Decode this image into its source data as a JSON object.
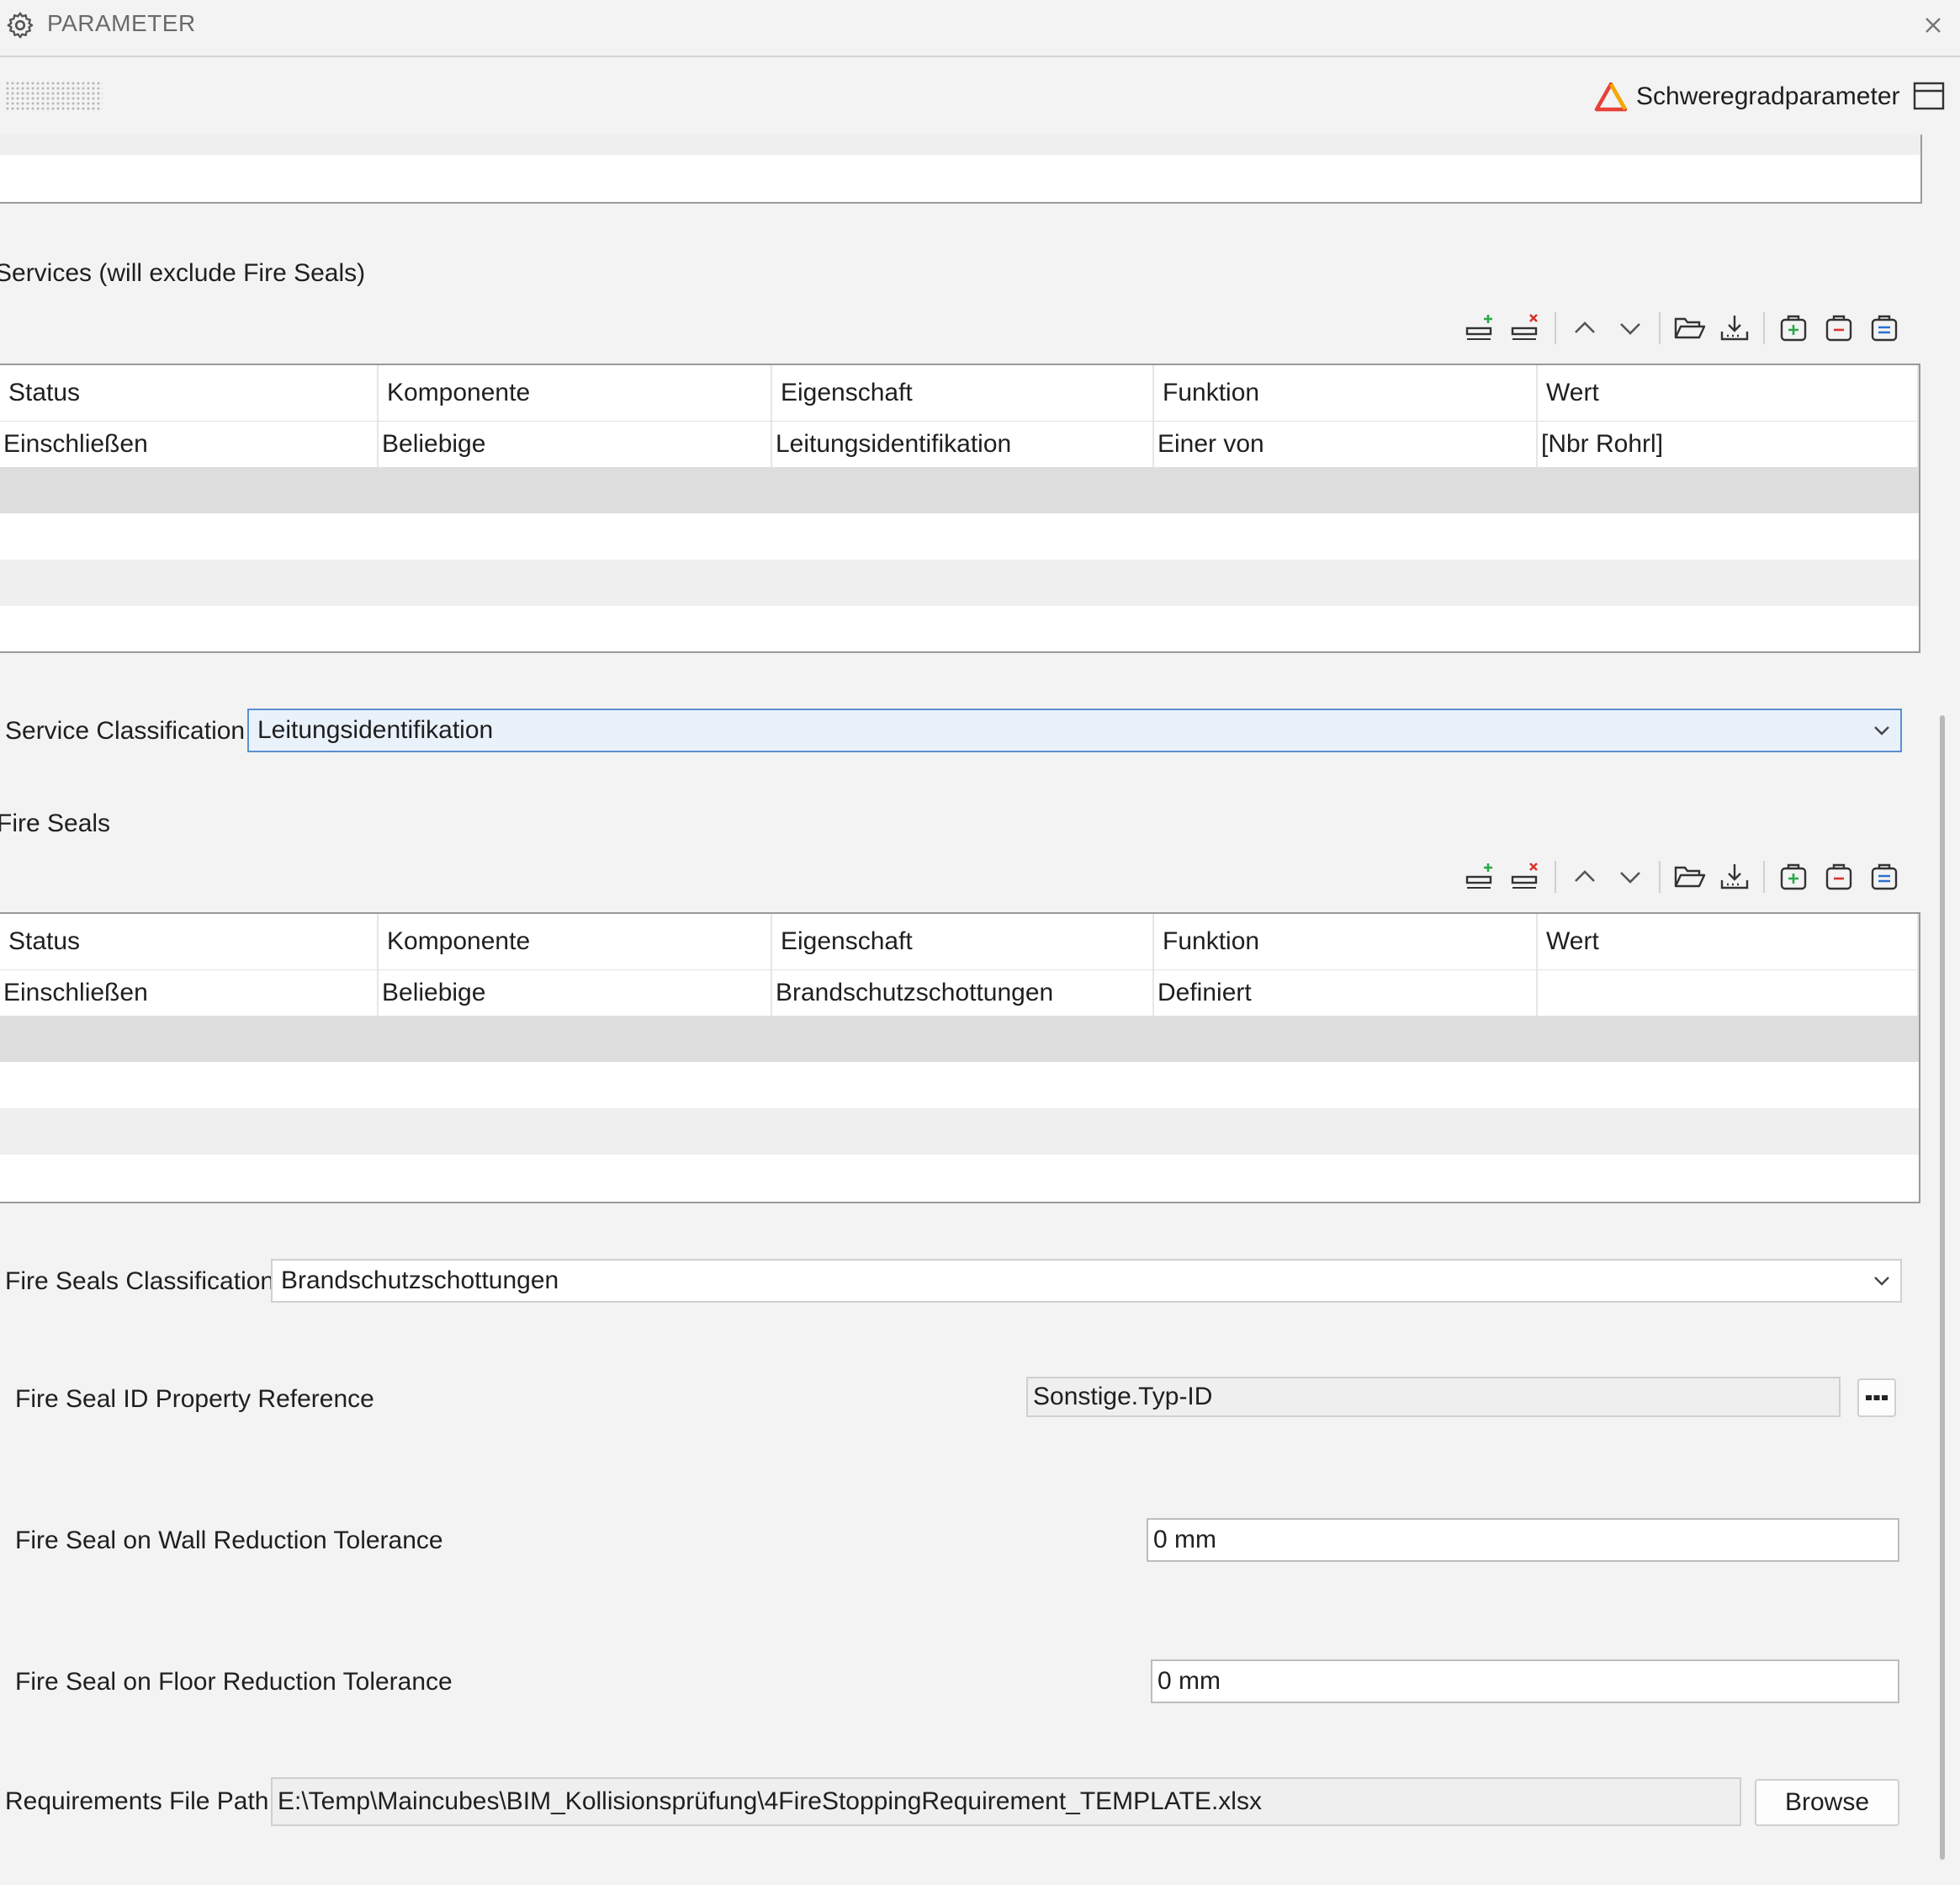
{
  "window": {
    "title": "PARAMETER",
    "icon": "gear-icon",
    "close_icon": "close-icon"
  },
  "header": {
    "severity_label": "Schweregradparameter",
    "severity_icon": "warning-triangle-icon",
    "layout_icon": "panel-layout-icon"
  },
  "colors": {
    "warning": "#e8403a",
    "warning_accent": "#f2a900",
    "add_green": "#2aa84a",
    "remove_red": "#d9342b",
    "focus_border": "#5b8fd1",
    "selected_row": "#dedede"
  },
  "toolbar_icons": [
    "add-row-icon",
    "delete-row-icon",
    "move-up-icon",
    "move-down-icon",
    "open-folder-icon",
    "download-icon",
    "add-item-icon",
    "remove-item-icon",
    "list-item-icon"
  ],
  "services": {
    "title": "Services (will exclude Fire Seals)",
    "columns": [
      "Status",
      "Komponente",
      "Eigenschaft",
      "Funktion",
      "Wert"
    ],
    "rows": [
      [
        "Einschließen",
        "Beliebige",
        "Leitungsidentifikation",
        "Einer von",
        "[Nbr Rohrl]"
      ]
    ]
  },
  "service_classification": {
    "label": "Service Classification",
    "value": "Leitungsidentifikation"
  },
  "fire_seals": {
    "title": "Fire Seals",
    "columns": [
      "Status",
      "Komponente",
      "Eigenschaft",
      "Funktion",
      "Wert"
    ],
    "rows": [
      [
        "Einschließen",
        "Beliebige",
        "Brandschutzschottungen",
        "Definiert",
        ""
      ]
    ]
  },
  "fire_seals_classification": {
    "label": "Fire Seals Classification",
    "value": "Brandschutzschottungen"
  },
  "fire_seal_id_ref": {
    "label": "Fire Seal ID Property Reference",
    "value": "Sonstige.Typ-ID",
    "button_icon": "more-options-icon"
  },
  "wall_tolerance": {
    "label": "Fire Seal on Wall Reduction Tolerance",
    "value": "0 mm"
  },
  "floor_tolerance": {
    "label": "Fire Seal on Floor Reduction Tolerance",
    "value": "0 mm"
  },
  "requirements_path": {
    "label": "Requirements File Path",
    "value": "E:\\Temp\\Maincubes\\BIM_Kollisionsprüfung\\4FireStoppingRequirement_TEMPLATE.xlsx",
    "button": "Browse"
  }
}
